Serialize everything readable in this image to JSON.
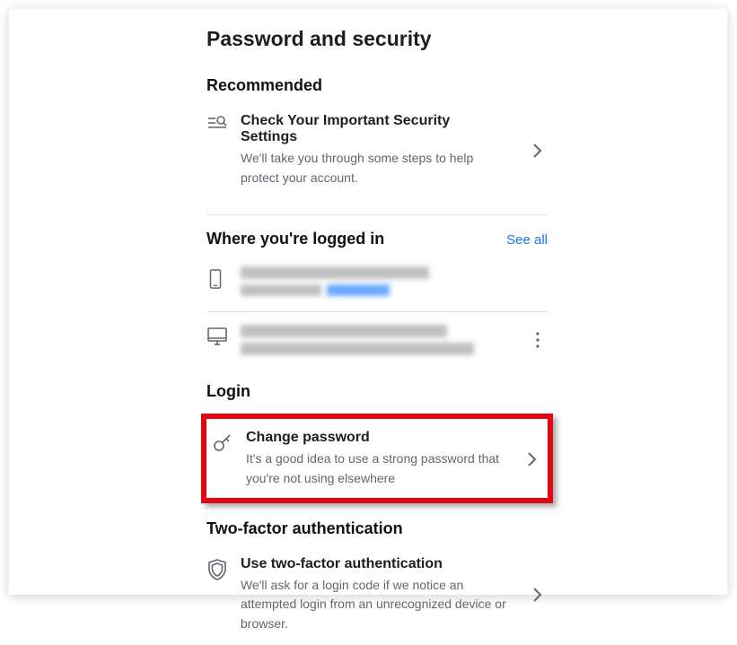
{
  "page": {
    "title": "Password and security"
  },
  "recommended": {
    "heading": "Recommended",
    "item": {
      "title": "Check Your Important Security Settings",
      "desc": "We'll take you through some steps to help protect your account."
    }
  },
  "sessions": {
    "heading": "Where you're logged in",
    "see_all": "See all"
  },
  "login": {
    "heading": "Login",
    "item": {
      "title": "Change password",
      "desc": "It's a good idea to use a strong password that you're not using elsewhere"
    }
  },
  "twofa": {
    "heading": "Two-factor authentication",
    "item": {
      "title": "Use two-factor authentication",
      "desc": "We'll ask for a login code if we notice an attempted login from an unrecognized device or browser."
    }
  }
}
